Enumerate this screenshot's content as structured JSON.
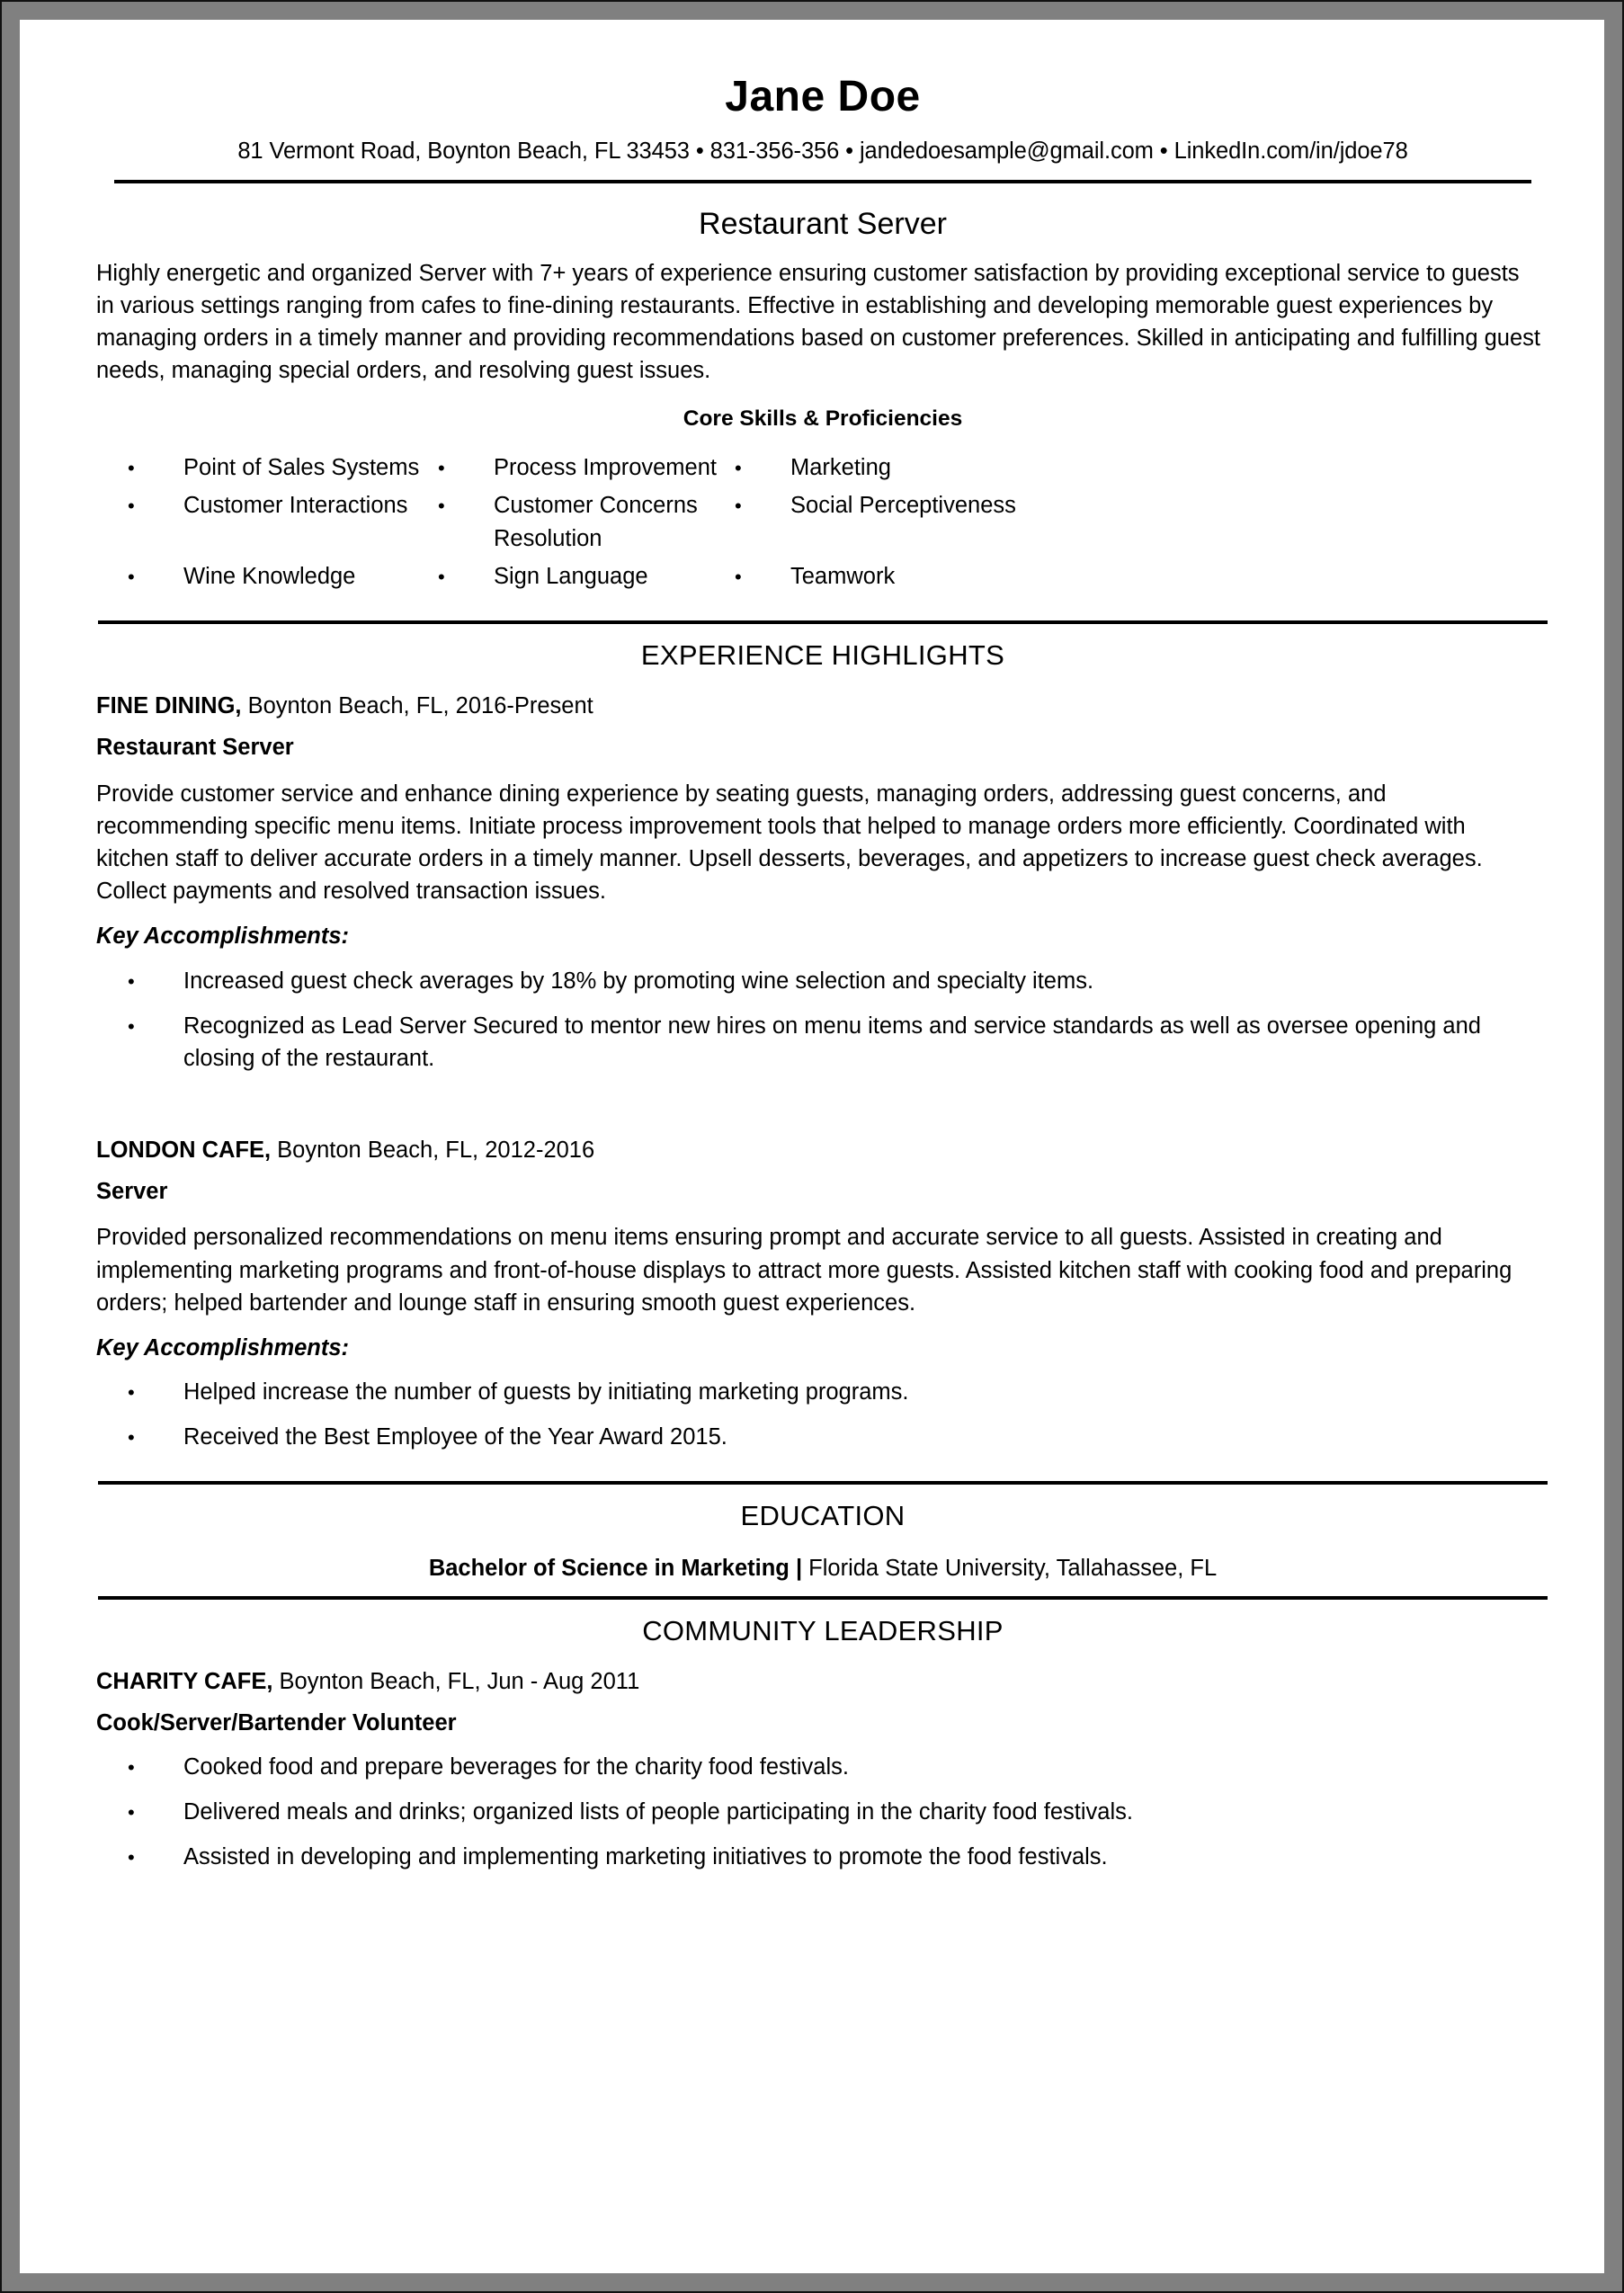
{
  "document": {
    "type": "resume",
    "colors": {
      "text": "#000000",
      "page": "#ffffff",
      "frame": "#808080",
      "rule": "#000000"
    }
  },
  "header": {
    "name": "Jane Doe",
    "contact": "81 Vermont Road, Boynton Beach, FL 33453 • 831-356-356 • jandedoesample@gmail.com • LinkedIn.com/in/jdoe78"
  },
  "summary": {
    "headline": "Restaurant Server",
    "paragraph": "Highly energetic and organized Server with 7+ years of experience ensuring customer satisfaction by providing exceptional service to guests in various settings ranging from cafes to fine-dining restaurants. Effective in establishing and developing memorable guest experiences by managing orders in a timely manner and providing recommendations based on customer preferences. Skilled in anticipating and fulfilling guest needs, managing special orders, and resolving guest issues."
  },
  "skills": {
    "title": "Core Skills & Proficiencies",
    "bullet_glyph": "•",
    "items": [
      "Point of Sales Systems",
      "Process Improvement",
      "Marketing",
      "Customer Interactions",
      "Customer Concerns Resolution",
      "Social Perceptiveness",
      "Wine Knowledge",
      "Sign Language",
      "Teamwork"
    ]
  },
  "experience": {
    "section_title": "EXPERIENCE HIGHLIGHTS",
    "key_accomplishments_label": "Key Accomplishments:",
    "jobs": [
      {
        "company": "FINE DINING,",
        "meta": " Boynton Beach, FL, 2016-Present",
        "role": "Restaurant Server",
        "description": "Provide customer service and enhance dining experience by seating guests, managing orders, addressing guest concerns, and recommending specific menu items. Initiate process improvement tools that helped to manage orders more efficiently. Coordinated with kitchen staff to deliver accurate orders in a timely manner. Upsell desserts, beverages, and appetizers to increase guest check averages. Collect payments and resolved transaction issues.",
        "accomplishments": [
          "Increased guest check averages by 18% by promoting wine selection and specialty items.",
          "Recognized as Lead Server Secured to mentor new hires on menu items and service standards as well as oversee opening and closing of the restaurant."
        ]
      },
      {
        "company": "LONDON CAFE,",
        "meta": " Boynton Beach, FL, 2012-2016",
        "role": "Server",
        "description": "Provided personalized recommendations on menu items ensuring prompt and accurate service to all guests. Assisted in creating and implementing marketing programs and front-of-house displays to attract more guests. Assisted kitchen staff with cooking food and preparing orders; helped bartender and lounge staff in ensuring smooth guest experiences.",
        "accomplishments": [
          "Helped increase the number of guests by initiating marketing programs.",
          "Received the Best Employee of the Year Award 2015."
        ]
      }
    ]
  },
  "education": {
    "section_title": "EDUCATION",
    "degree": "Bachelor of Science in Marketing |",
    "institution": " Florida State University, Tallahassee, FL"
  },
  "community": {
    "section_title": "COMMUNITY LEADERSHIP",
    "organization": "CHARITY CAFE,",
    "meta": " Boynton Beach, FL, Jun - Aug 2011",
    "role": "Cook/Server/Bartender Volunteer",
    "bullets": [
      "Cooked food and prepare beverages for the charity food festivals.",
      "Delivered meals and drinks; organized lists of people participating in the charity food festivals.",
      "Assisted in developing and implementing marketing initiatives to promote the food festivals."
    ]
  }
}
